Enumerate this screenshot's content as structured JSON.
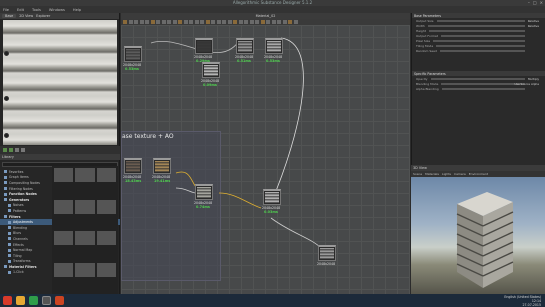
{
  "window": {
    "title": "Allegorithmic Substance Designer 5.1.2",
    "controls": [
      "–",
      "□",
      "×"
    ]
  },
  "menu": [
    "File",
    "Edit",
    "Tools",
    "Windows",
    "Help"
  ],
  "left_panel": {
    "tabs": [
      "Base",
      "2D View"
    ],
    "tools_tab": "Explorer",
    "library_header": "Library",
    "library_tree": [
      {
        "label": "Favorites",
        "level": 0
      },
      {
        "label": "Graph Items",
        "level": 0
      },
      {
        "label": "Compositing Nodes",
        "level": 0
      },
      {
        "label": "Filtering Nodes",
        "level": 0
      },
      {
        "label": "Function Nodes",
        "level": 0,
        "head": true
      },
      {
        "label": "Generators",
        "level": 0,
        "head": true
      },
      {
        "label": "Noises",
        "level": 1
      },
      {
        "label": "Patterns",
        "level": 1
      },
      {
        "label": "Filters",
        "level": 0,
        "head": true
      },
      {
        "label": "Adjustments",
        "level": 1,
        "selected": true
      },
      {
        "label": "Blending",
        "level": 1
      },
      {
        "label": "Blurs",
        "level": 1
      },
      {
        "label": "Channels",
        "level": 1
      },
      {
        "label": "Effects",
        "level": 1
      },
      {
        "label": "Normal Map",
        "level": 1
      },
      {
        "label": "Tiling",
        "level": 1
      },
      {
        "label": "Transforms",
        "level": 1
      },
      {
        "label": "Material Filters",
        "level": 0,
        "head": true
      },
      {
        "label": "1-Click",
        "level": 1
      }
    ]
  },
  "graph": {
    "header": "Material_02",
    "frame_label": "ase texture + AO",
    "nodes": [
      {
        "id": "n1",
        "size": "2048x2048",
        "time": "0.53ms"
      },
      {
        "id": "n2",
        "size": "2048x2048",
        "time": "0.29ms"
      },
      {
        "id": "n3",
        "size": "2048x2048",
        "time": "0.51ms"
      },
      {
        "id": "n4",
        "size": "2048x2048",
        "time": "0.53ms"
      },
      {
        "id": "n5",
        "size": "2048x2048",
        "time": "0.09ms"
      },
      {
        "id": "n6",
        "size": "2048x2048",
        "time": "18.43ms"
      },
      {
        "id": "n7",
        "size": "2048x2048",
        "time": "19.41ms"
      },
      {
        "id": "n8",
        "size": "2048x2048",
        "time": "0.74ms"
      },
      {
        "id": "n9",
        "size": "2048x2048",
        "time": "0.03ms"
      },
      {
        "id": "n10",
        "size": "2048x2048",
        "time": ""
      }
    ]
  },
  "properties": {
    "section1": "Base Parameters",
    "rows1": [
      "Output Size",
      "Width",
      "Height",
      "Output Format",
      "Pixel Size",
      "Tiling Mode",
      "Random Seed"
    ],
    "values1": [
      "Relative",
      "Relative"
    ],
    "section2": "Specific Parameters",
    "rows2": [
      "Opacity",
      "Blending Mode",
      "Alpha Blending"
    ],
    "values2": [
      "Multiply",
      "Use Source Alpha"
    ]
  },
  "view3d": {
    "header": "3D View",
    "tools": [
      "Scene",
      "Materials",
      "Lights",
      "Camera",
      "Environment"
    ]
  },
  "taskbar": {
    "time": "12:14",
    "date": "27-07-2015",
    "lang": "English (United States)"
  },
  "colors": {
    "time_green": "#4fd04f",
    "selection_blue": "#3c5a7a",
    "graph_bg": "#47494a"
  }
}
